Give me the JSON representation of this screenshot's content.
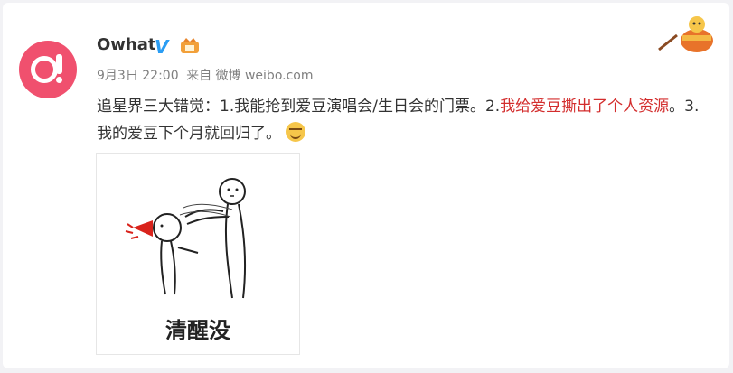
{
  "post": {
    "username": "Owhat",
    "verified_label": "V",
    "meta": {
      "date": "9月3日 22:00",
      "from": "来自 微博 weibo.com"
    },
    "text_part1": "追星界三大错觉：1.我能抢到爱豆演唱会/生日会的门票。2.",
    "text_red": "我给爱豆撕出了个人资源",
    "text_part2": "。3.我的爱豆下个月就回归了。",
    "emoji": "smirk-emoji",
    "image_caption": "清醒没"
  },
  "colors": {
    "avatar": "#f0506e",
    "verified": "#2a9df4",
    "highlight": "#d32d2d"
  }
}
